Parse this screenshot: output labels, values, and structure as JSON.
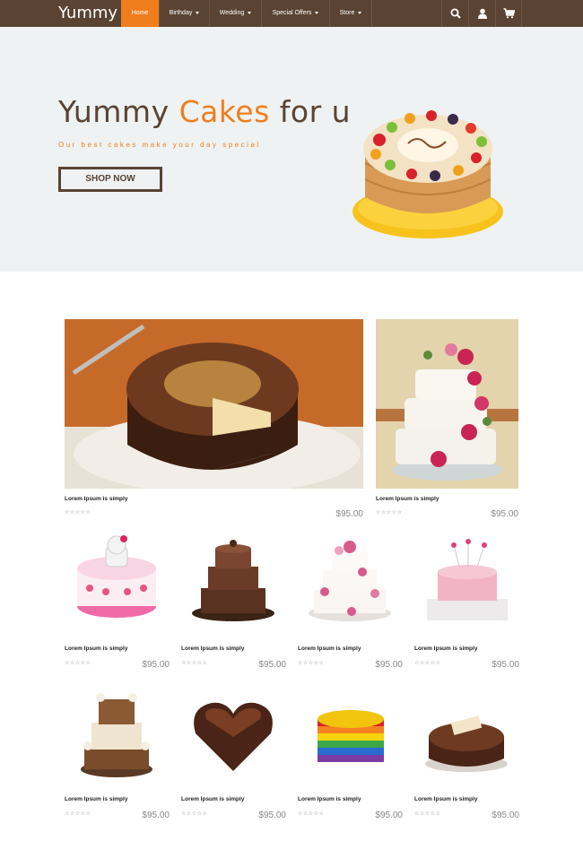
{
  "nav": {
    "brand": "Yummy",
    "items": [
      {
        "label": "Home",
        "active": true,
        "caret": false
      },
      {
        "label": "Birthday",
        "active": false,
        "caret": true
      },
      {
        "label": "Wedding",
        "active": false,
        "caret": true
      },
      {
        "label": "Special Offers",
        "active": false,
        "caret": true
      },
      {
        "label": "Store",
        "active": false,
        "caret": true
      }
    ],
    "icons": [
      "search-icon",
      "user-icon",
      "cart-icon"
    ],
    "colors": {
      "bar": "#5a4333",
      "active": "#f07e1d"
    }
  },
  "hero": {
    "title_part1": "Yummy ",
    "title_accent": "Cakes",
    "title_part2": " for u",
    "subtitle": "Our best cakes make your day special",
    "button": "SHOP NOW"
  },
  "products": {
    "featured": [
      {
        "name": "Lorem Ipsum is simply",
        "rating": "☆☆☆☆☆",
        "price": "$95.00"
      },
      {
        "name": "Lorem Ipsum is simply",
        "rating": "☆☆☆☆☆",
        "price": "$95.00"
      }
    ],
    "row1": [
      {
        "name": "Lorem Ipsum is simply",
        "rating": "☆☆☆☆☆",
        "price": "$95.00"
      },
      {
        "name": "Lorem Ipsum is simply",
        "rating": "☆☆☆☆☆",
        "price": "$95.00"
      },
      {
        "name": "Lorem Ipsum is simply",
        "rating": "☆☆☆☆☆",
        "price": "$95.00"
      },
      {
        "name": "Lorem Ipsum is simply",
        "rating": "☆☆☆☆☆",
        "price": "$95.00"
      }
    ],
    "row2": [
      {
        "name": "Lorem Ipsum is simply",
        "rating": "☆☆☆☆☆",
        "price": "$95.00"
      },
      {
        "name": "Lorem Ipsum is simply",
        "rating": "☆☆☆☆☆",
        "price": "$95.00"
      },
      {
        "name": "Lorem Ipsum is simply",
        "rating": "☆☆☆☆☆",
        "price": "$95.00"
      },
      {
        "name": "Lorem Ipsum is simply",
        "rating": "☆☆☆☆☆",
        "price": "$95.00"
      }
    ]
  }
}
